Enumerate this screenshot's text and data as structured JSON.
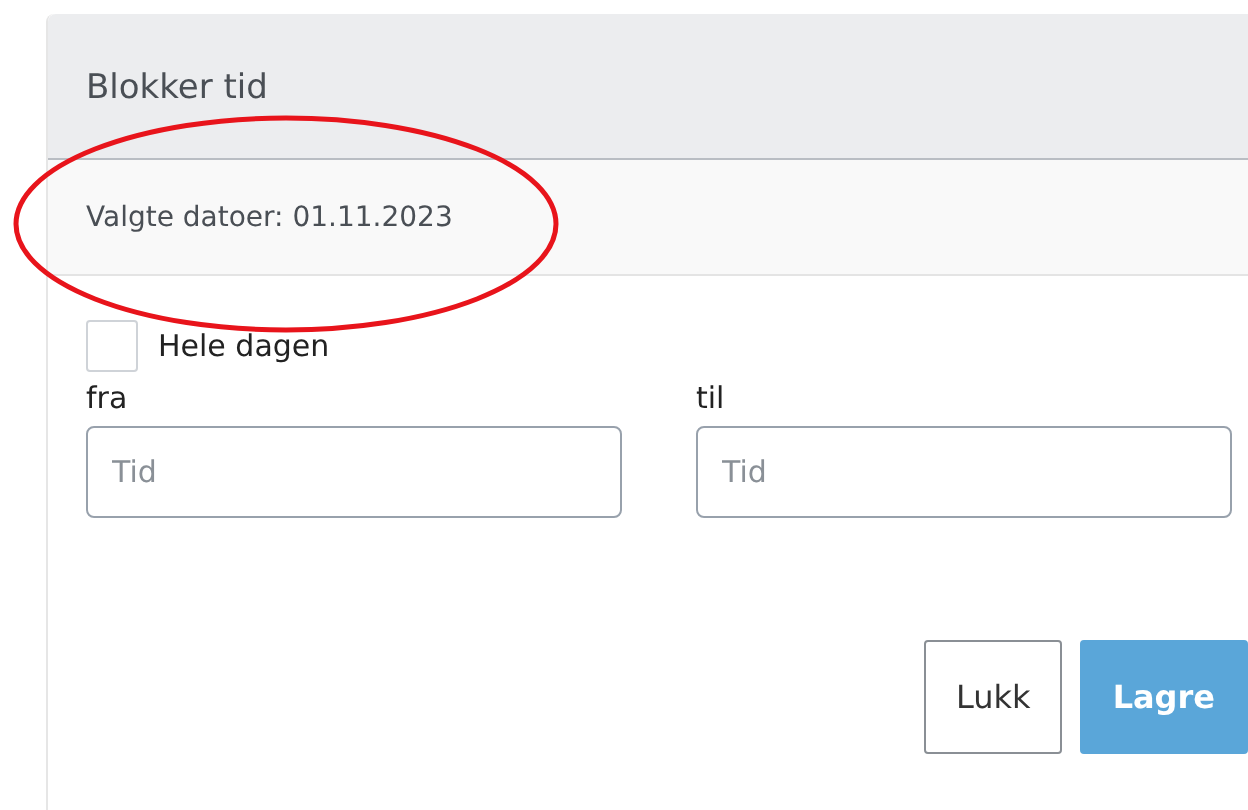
{
  "dialog": {
    "title": "Blokker tid",
    "subtitle": "Valgte datoer: 01.11.2023"
  },
  "annotation": {
    "kind": "ellipse"
  },
  "all_day": {
    "label": "Hele dagen",
    "checked": false
  },
  "fields": [
    {
      "label": "fra",
      "placeholder": "Tid"
    },
    {
      "label": "til",
      "placeholder": "Tid"
    }
  ],
  "buttons": [
    {
      "label": "Lukk",
      "kind": "secondary"
    },
    {
      "label": "Lagre",
      "kind": "primary"
    }
  ]
}
